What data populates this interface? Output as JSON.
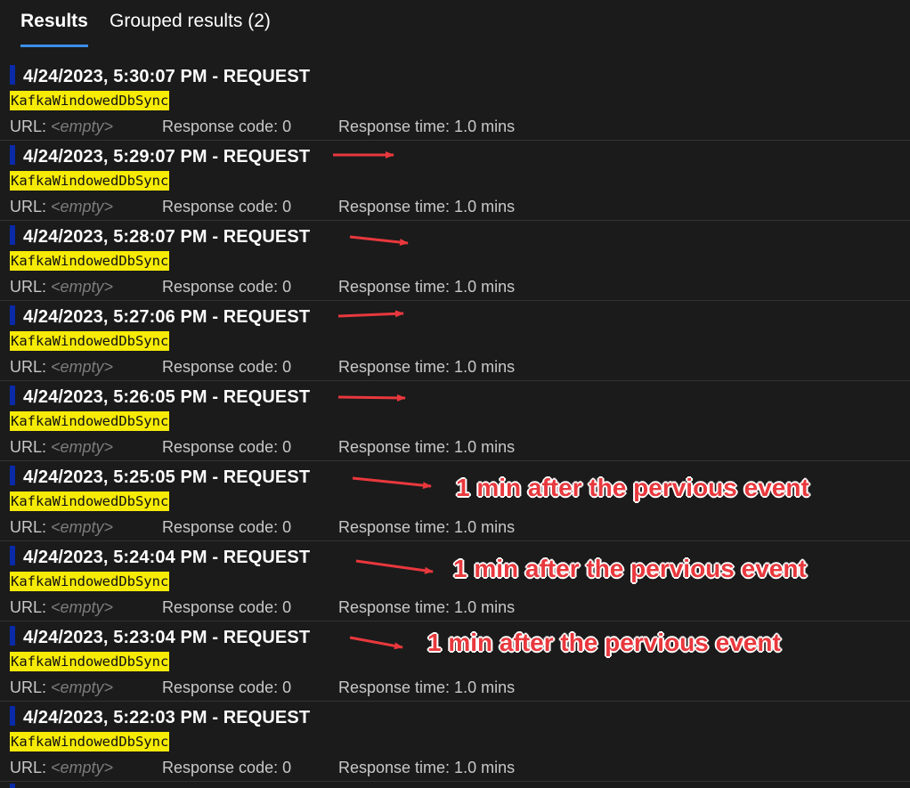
{
  "tabs": {
    "results": "Results",
    "grouped": "Grouped results (2)"
  },
  "rows": [
    {
      "title": "4/24/2023, 5:30:07 PM - REQUEST",
      "name": "KafkaWindowedDbSync",
      "url_label": "URL:",
      "url_value": "<empty>",
      "response_code": "Response code: 0",
      "response_time": "Response time: 1.0 mins"
    },
    {
      "title": "4/24/2023, 5:29:07 PM - REQUEST",
      "name": "KafkaWindowedDbSync",
      "url_label": "URL:",
      "url_value": "<empty>",
      "response_code": "Response code: 0",
      "response_time": "Response time: 1.0 mins"
    },
    {
      "title": "4/24/2023, 5:28:07 PM - REQUEST",
      "name": "KafkaWindowedDbSync",
      "url_label": "URL:",
      "url_value": "<empty>",
      "response_code": "Response code: 0",
      "response_time": "Response time: 1.0 mins"
    },
    {
      "title": "4/24/2023, 5:27:06 PM - REQUEST",
      "name": "KafkaWindowedDbSync",
      "url_label": "URL:",
      "url_value": "<empty>",
      "response_code": "Response code: 0",
      "response_time": "Response time: 1.0 mins"
    },
    {
      "title": "4/24/2023, 5:26:05 PM - REQUEST",
      "name": "KafkaWindowedDbSync",
      "url_label": "URL:",
      "url_value": "<empty>",
      "response_code": "Response code: 0",
      "response_time": "Response time: 1.0 mins"
    },
    {
      "title": "4/24/2023, 5:25:05 PM - REQUEST",
      "name": "KafkaWindowedDbSync",
      "url_label": "URL:",
      "url_value": "<empty>",
      "response_code": "Response code: 0",
      "response_time": "Response time: 1.0 mins"
    },
    {
      "title": "4/24/2023, 5:24:04 PM - REQUEST",
      "name": "KafkaWindowedDbSync",
      "url_label": "URL:",
      "url_value": "<empty>",
      "response_code": "Response code: 0",
      "response_time": "Response time: 1.0 mins"
    },
    {
      "title": "4/24/2023, 5:23:04 PM - REQUEST",
      "name": "KafkaWindowedDbSync",
      "url_label": "URL:",
      "url_value": "<empty>",
      "response_code": "Response code: 0",
      "response_time": "Response time: 1.0 mins"
    },
    {
      "title": "4/24/2023, 5:22:03 PM - REQUEST",
      "name": "KafkaWindowedDbSync",
      "url_label": "URL:",
      "url_value": "<empty>",
      "response_code": "Response code: 0",
      "response_time": "Response time: 1.0 mins"
    }
  ],
  "annotations": {
    "notes": [
      "1 min after the pervious event",
      "1 min after the pervious event",
      "1 min after the pervious event"
    ],
    "color": "#e8383d"
  },
  "colors": {
    "background": "#1b1b1b",
    "tab_underline": "#3b8ee8",
    "request_marker": "#0a2aa8",
    "name_highlight": "#f6ea07"
  }
}
